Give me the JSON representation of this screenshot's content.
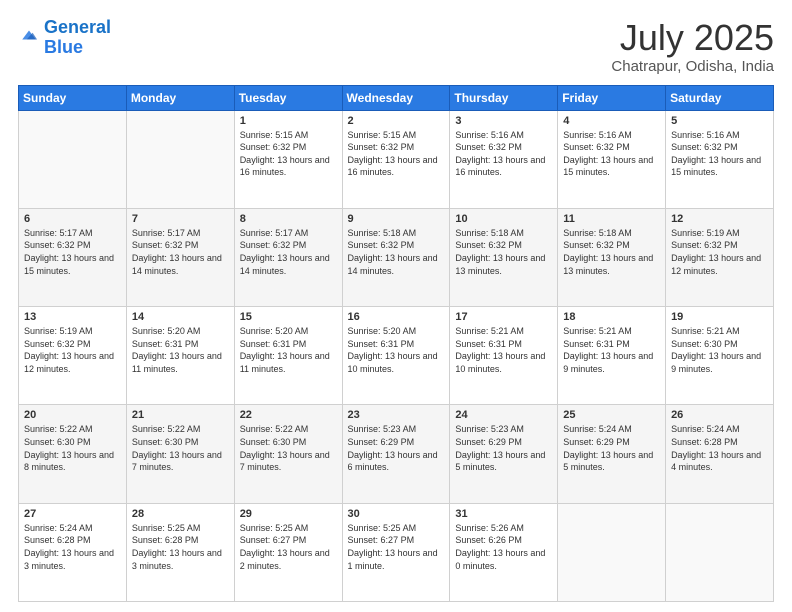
{
  "header": {
    "logo_line1": "General",
    "logo_line2": "Blue",
    "month": "July 2025",
    "location": "Chatrapur, Odisha, India"
  },
  "weekdays": [
    "Sunday",
    "Monday",
    "Tuesday",
    "Wednesday",
    "Thursday",
    "Friday",
    "Saturday"
  ],
  "weeks": [
    [
      {
        "day": "",
        "sunrise": "",
        "sunset": "",
        "daylight": ""
      },
      {
        "day": "",
        "sunrise": "",
        "sunset": "",
        "daylight": ""
      },
      {
        "day": "1",
        "sunrise": "Sunrise: 5:15 AM",
        "sunset": "Sunset: 6:32 PM",
        "daylight": "Daylight: 13 hours and 16 minutes."
      },
      {
        "day": "2",
        "sunrise": "Sunrise: 5:15 AM",
        "sunset": "Sunset: 6:32 PM",
        "daylight": "Daylight: 13 hours and 16 minutes."
      },
      {
        "day": "3",
        "sunrise": "Sunrise: 5:16 AM",
        "sunset": "Sunset: 6:32 PM",
        "daylight": "Daylight: 13 hours and 16 minutes."
      },
      {
        "day": "4",
        "sunrise": "Sunrise: 5:16 AM",
        "sunset": "Sunset: 6:32 PM",
        "daylight": "Daylight: 13 hours and 15 minutes."
      },
      {
        "day": "5",
        "sunrise": "Sunrise: 5:16 AM",
        "sunset": "Sunset: 6:32 PM",
        "daylight": "Daylight: 13 hours and 15 minutes."
      }
    ],
    [
      {
        "day": "6",
        "sunrise": "Sunrise: 5:17 AM",
        "sunset": "Sunset: 6:32 PM",
        "daylight": "Daylight: 13 hours and 15 minutes."
      },
      {
        "day": "7",
        "sunrise": "Sunrise: 5:17 AM",
        "sunset": "Sunset: 6:32 PM",
        "daylight": "Daylight: 13 hours and 14 minutes."
      },
      {
        "day": "8",
        "sunrise": "Sunrise: 5:17 AM",
        "sunset": "Sunset: 6:32 PM",
        "daylight": "Daylight: 13 hours and 14 minutes."
      },
      {
        "day": "9",
        "sunrise": "Sunrise: 5:18 AM",
        "sunset": "Sunset: 6:32 PM",
        "daylight": "Daylight: 13 hours and 14 minutes."
      },
      {
        "day": "10",
        "sunrise": "Sunrise: 5:18 AM",
        "sunset": "Sunset: 6:32 PM",
        "daylight": "Daylight: 13 hours and 13 minutes."
      },
      {
        "day": "11",
        "sunrise": "Sunrise: 5:18 AM",
        "sunset": "Sunset: 6:32 PM",
        "daylight": "Daylight: 13 hours and 13 minutes."
      },
      {
        "day": "12",
        "sunrise": "Sunrise: 5:19 AM",
        "sunset": "Sunset: 6:32 PM",
        "daylight": "Daylight: 13 hours and 12 minutes."
      }
    ],
    [
      {
        "day": "13",
        "sunrise": "Sunrise: 5:19 AM",
        "sunset": "Sunset: 6:32 PM",
        "daylight": "Daylight: 13 hours and 12 minutes."
      },
      {
        "day": "14",
        "sunrise": "Sunrise: 5:20 AM",
        "sunset": "Sunset: 6:31 PM",
        "daylight": "Daylight: 13 hours and 11 minutes."
      },
      {
        "day": "15",
        "sunrise": "Sunrise: 5:20 AM",
        "sunset": "Sunset: 6:31 PM",
        "daylight": "Daylight: 13 hours and 11 minutes."
      },
      {
        "day": "16",
        "sunrise": "Sunrise: 5:20 AM",
        "sunset": "Sunset: 6:31 PM",
        "daylight": "Daylight: 13 hours and 10 minutes."
      },
      {
        "day": "17",
        "sunrise": "Sunrise: 5:21 AM",
        "sunset": "Sunset: 6:31 PM",
        "daylight": "Daylight: 13 hours and 10 minutes."
      },
      {
        "day": "18",
        "sunrise": "Sunrise: 5:21 AM",
        "sunset": "Sunset: 6:31 PM",
        "daylight": "Daylight: 13 hours and 9 minutes."
      },
      {
        "day": "19",
        "sunrise": "Sunrise: 5:21 AM",
        "sunset": "Sunset: 6:30 PM",
        "daylight": "Daylight: 13 hours and 9 minutes."
      }
    ],
    [
      {
        "day": "20",
        "sunrise": "Sunrise: 5:22 AM",
        "sunset": "Sunset: 6:30 PM",
        "daylight": "Daylight: 13 hours and 8 minutes."
      },
      {
        "day": "21",
        "sunrise": "Sunrise: 5:22 AM",
        "sunset": "Sunset: 6:30 PM",
        "daylight": "Daylight: 13 hours and 7 minutes."
      },
      {
        "day": "22",
        "sunrise": "Sunrise: 5:22 AM",
        "sunset": "Sunset: 6:30 PM",
        "daylight": "Daylight: 13 hours and 7 minutes."
      },
      {
        "day": "23",
        "sunrise": "Sunrise: 5:23 AM",
        "sunset": "Sunset: 6:29 PM",
        "daylight": "Daylight: 13 hours and 6 minutes."
      },
      {
        "day": "24",
        "sunrise": "Sunrise: 5:23 AM",
        "sunset": "Sunset: 6:29 PM",
        "daylight": "Daylight: 13 hours and 5 minutes."
      },
      {
        "day": "25",
        "sunrise": "Sunrise: 5:24 AM",
        "sunset": "Sunset: 6:29 PM",
        "daylight": "Daylight: 13 hours and 5 minutes."
      },
      {
        "day": "26",
        "sunrise": "Sunrise: 5:24 AM",
        "sunset": "Sunset: 6:28 PM",
        "daylight": "Daylight: 13 hours and 4 minutes."
      }
    ],
    [
      {
        "day": "27",
        "sunrise": "Sunrise: 5:24 AM",
        "sunset": "Sunset: 6:28 PM",
        "daylight": "Daylight: 13 hours and 3 minutes."
      },
      {
        "day": "28",
        "sunrise": "Sunrise: 5:25 AM",
        "sunset": "Sunset: 6:28 PM",
        "daylight": "Daylight: 13 hours and 3 minutes."
      },
      {
        "day": "29",
        "sunrise": "Sunrise: 5:25 AM",
        "sunset": "Sunset: 6:27 PM",
        "daylight": "Daylight: 13 hours and 2 minutes."
      },
      {
        "day": "30",
        "sunrise": "Sunrise: 5:25 AM",
        "sunset": "Sunset: 6:27 PM",
        "daylight": "Daylight: 13 hours and 1 minute."
      },
      {
        "day": "31",
        "sunrise": "Sunrise: 5:26 AM",
        "sunset": "Sunset: 6:26 PM",
        "daylight": "Daylight: 13 hours and 0 minutes."
      },
      {
        "day": "",
        "sunrise": "",
        "sunset": "",
        "daylight": ""
      },
      {
        "day": "",
        "sunrise": "",
        "sunset": "",
        "daylight": ""
      }
    ]
  ]
}
